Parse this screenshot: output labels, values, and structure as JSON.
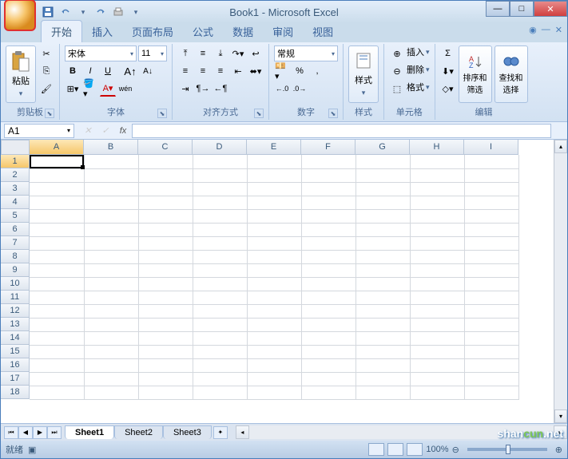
{
  "title": "Book1 - Microsoft Excel",
  "qat": {
    "save": "save",
    "undo": "undo",
    "redo": "redo",
    "print": "print"
  },
  "tabs": [
    "开始",
    "插入",
    "页面布局",
    "公式",
    "数据",
    "审阅",
    "视图"
  ],
  "active_tab": 0,
  "ribbon": {
    "clipboard": {
      "label": "剪贴板",
      "paste": "粘贴"
    },
    "font": {
      "label": "字体",
      "family": "宋体",
      "size": "11",
      "bold": "B",
      "italic": "I",
      "underline": "U",
      "grow": "A",
      "shrink": "A"
    },
    "alignment": {
      "label": "对齐方式"
    },
    "number": {
      "label": "数字",
      "format": "常规",
      "currency": "¥",
      "percent": "%",
      "comma": ",",
      "inc_dec": "←.0",
      "dec_dec": ".00→"
    },
    "styles": {
      "label": "样式",
      "styles_btn": "样式"
    },
    "cells": {
      "label": "单元格",
      "insert": "插入",
      "delete": "删除",
      "format": "格式"
    },
    "editing": {
      "label": "编辑",
      "sum": "Σ",
      "fill": "↓",
      "clear": "◇",
      "sort": "排序和\n筛选",
      "find": "查找和\n选择"
    }
  },
  "namebox": "A1",
  "columns": [
    "A",
    "B",
    "C",
    "D",
    "E",
    "F",
    "G",
    "H",
    "I"
  ],
  "rows": [
    1,
    2,
    3,
    4,
    5,
    6,
    7,
    8,
    9,
    10,
    11,
    12,
    13,
    14,
    15,
    16,
    17,
    18
  ],
  "selected": {
    "col": 0,
    "row": 0
  },
  "sheets": [
    "Sheet1",
    "Sheet2",
    "Sheet3"
  ],
  "active_sheet": 0,
  "status": "就绪",
  "zoom": "100%",
  "watermark": {
    "a": "shan",
    "b": "cun",
    "c": ".net"
  }
}
